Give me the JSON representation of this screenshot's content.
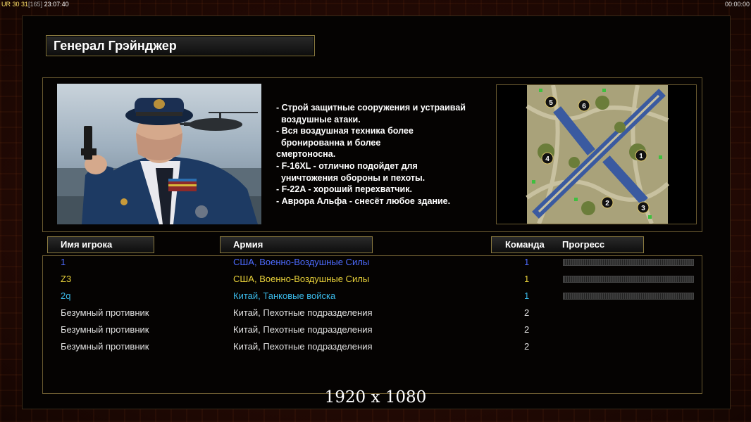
{
  "topbar": {
    "ur_label": "UR",
    "ur_values": "30 31",
    "frame_count": "[165]",
    "clock": "23:07:40",
    "timer": "00:00:00"
  },
  "general": {
    "title": "Генерал Грэйнджер",
    "description": [
      "- Строй защитные сооружения и устраивай",
      "  воздушные атаки.",
      "- Вся воздушная техника более",
      "  бронированна и более",
      "смертоносна.",
      "- F-16XL - отлично подойдет для",
      "  уничтожения обороны и пехоты.",
      "- F-22A - хороший перехватчик.",
      "- Аврора Альфа - снесёт любое здание."
    ]
  },
  "map": {
    "start_positions": [
      "1",
      "2",
      "3",
      "4",
      "5",
      "6"
    ]
  },
  "table": {
    "col_player": "Имя игрока",
    "col_army": "Армия",
    "col_team": "Команда",
    "col_progress": "Прогресс",
    "rows": [
      {
        "name": "1",
        "army": "США, Военно-Воздушные Силы",
        "team": "1",
        "color": "#4d6bff",
        "progress": true
      },
      {
        "name": "Z3",
        "army": "США, Военно-Воздушные Силы",
        "team": "1",
        "color": "#e9d23a",
        "progress": true
      },
      {
        "name": "2q",
        "army": "Китай, Танковые войска",
        "team": "1",
        "color": "#3ab9e8",
        "progress": true
      },
      {
        "name": "Безумный противник",
        "army": "Китай, Пехотные подразделения",
        "team": "2",
        "color": "#e0e0e0",
        "progress": false
      },
      {
        "name": "Безумный противник",
        "army": "Китай, Пехотные подразделения",
        "team": "2",
        "color": "#e0e0e0",
        "progress": false
      },
      {
        "name": "Безумный противник",
        "army": "Китай, Пехотные подразделения",
        "team": "2",
        "color": "#e0e0e0",
        "progress": false
      }
    ]
  },
  "resolution": "1920 x 1080"
}
